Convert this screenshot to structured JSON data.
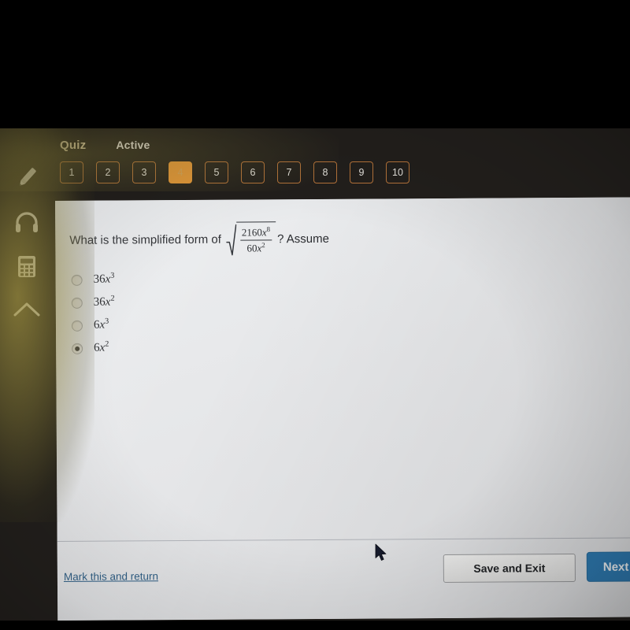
{
  "app": {
    "quiz_label": "Quiz",
    "status_label": "Active"
  },
  "question_nav": {
    "items": [
      {
        "label": "1",
        "active": false
      },
      {
        "label": "2",
        "active": false
      },
      {
        "label": "3",
        "active": false
      },
      {
        "label": "4",
        "active": true
      },
      {
        "label": "5",
        "active": false
      },
      {
        "label": "6",
        "active": false
      },
      {
        "label": "7",
        "active": false
      },
      {
        "label": "8",
        "active": false
      },
      {
        "label": "9",
        "active": false
      },
      {
        "label": "10",
        "active": true
      }
    ]
  },
  "tool_rail": {
    "items": [
      {
        "icon": "pencil-icon",
        "name": "highlighter-tool"
      },
      {
        "icon": "headphones-icon",
        "name": "audio-tool"
      },
      {
        "icon": "calculator-icon",
        "name": "calculator-tool"
      },
      {
        "icon": "chevron-up-icon",
        "name": "collapse-tool"
      }
    ]
  },
  "question": {
    "text_before": "What is the simplified form of",
    "text_after": "? Assume",
    "expression": {
      "type": "square-root-of-fraction",
      "numerator_coefficient": "2160",
      "numerator_variable": "x",
      "numerator_exponent": "8",
      "denominator_coefficient": "60",
      "denominator_variable": "x",
      "denominator_exponent": "2",
      "numerator_plain": "2160x8",
      "denominator_plain": "60x2"
    }
  },
  "options": [
    {
      "coefficient": "36",
      "variable": "x",
      "exponent": "3",
      "plain": "36x3",
      "selected": false
    },
    {
      "coefficient": "36",
      "variable": "x",
      "exponent": "2",
      "plain": "36x2",
      "selected": false
    },
    {
      "coefficient": "6",
      "variable": "x",
      "exponent": "3",
      "plain": "6x3",
      "selected": false
    },
    {
      "coefficient": "6",
      "variable": "x",
      "exponent": "2",
      "plain": "6x2",
      "selected": true
    }
  ],
  "footer": {
    "save_label": "Save and Exit",
    "next_label": "Next",
    "mark_return_label": "Mark this and return"
  },
  "colors": {
    "accent_orange": "#e79838",
    "nav_border": "#b5733a",
    "next_blue": "#2f7cb4",
    "link_blue": "#2f5f86",
    "quiz_label": "#d8c9a4",
    "card_bg": "#e9eaec",
    "chrome_bg": "#221f1c"
  }
}
